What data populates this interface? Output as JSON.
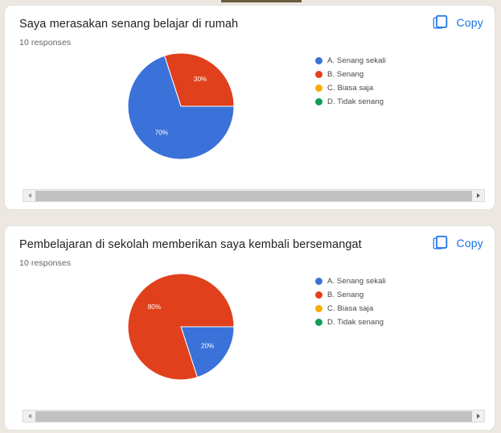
{
  "page": {
    "background_color": "#ece8e1",
    "tab_underline_color": "#6b5b3e"
  },
  "palette": {
    "blue": "#3b72d9",
    "red": "#e1401c",
    "amber": "#f9ab00",
    "green": "#109d58",
    "link_blue": "#1a73e8"
  },
  "cards": [
    {
      "title": "Saya merasakan senang belajar di rumah",
      "responses": "10 responses",
      "copy_label": "Copy",
      "chart_data": {
        "type": "pie",
        "title": "Saya merasakan senang belajar di rumah",
        "total_responses": 10,
        "categories": [
          "A. Senang sekali",
          "B. Senang",
          "C. Biasa saja",
          "D. Tidak senang"
        ],
        "values": [
          70,
          30,
          0,
          0
        ],
        "value_labels": [
          "70%",
          "30%",
          "",
          ""
        ],
        "colors": [
          "#3b72d9",
          "#e1401c",
          "#f9ab00",
          "#109d58"
        ],
        "legend": [
          "A. Senang sekali",
          "B. Senang",
          "C. Biasa saja",
          "D. Tidak senang"
        ],
        "legend_position": "right",
        "start_angle_deg": -18,
        "slices": [
          {
            "label": "A. Senang sekali",
            "percent": 70,
            "text": "70%",
            "color": "#3b72d9",
            "start_deg": 90,
            "sweep_deg": 252
          },
          {
            "label": "B. Senang",
            "percent": 30,
            "text": "30%",
            "color": "#e1401c",
            "start_deg": 342,
            "sweep_deg": 108
          },
          {
            "label": "C. Biasa saja",
            "percent": 0,
            "text": "",
            "color": "#f9ab00",
            "start_deg": 90,
            "sweep_deg": 0
          },
          {
            "label": "D. Tidak senang",
            "percent": 0,
            "text": "",
            "color": "#109d58",
            "start_deg": 90,
            "sweep_deg": 0
          }
        ]
      }
    },
    {
      "title": "Pembelajaran di sekolah memberikan saya kembali bersemangat",
      "responses": "10 responses",
      "copy_label": "Copy",
      "chart_data": {
        "type": "pie",
        "title": "Pembelajaran di sekolah memberikan saya kembali bersemangat",
        "total_responses": 10,
        "categories": [
          "A. Senang sekali",
          "B. Senang",
          "C. Biasa saja",
          "D. Tidak senang"
        ],
        "values": [
          20,
          80,
          0,
          0
        ],
        "value_labels": [
          "20%",
          "80%",
          "",
          ""
        ],
        "colors": [
          "#3b72d9",
          "#e1401c",
          "#f9ab00",
          "#109d58"
        ],
        "legend": [
          "A. Senang sekali",
          "B. Senang",
          "C. Biasa saja",
          "D. Tidak senang"
        ],
        "legend_position": "right",
        "start_angle_deg": 90,
        "slices": [
          {
            "label": "A. Senang sekali",
            "percent": 20,
            "text": "20%",
            "color": "#3b72d9",
            "start_deg": 90,
            "sweep_deg": 72
          },
          {
            "label": "B. Senang",
            "percent": 80,
            "text": "80%",
            "color": "#e1401c",
            "start_deg": 162,
            "sweep_deg": 288
          },
          {
            "label": "C. Biasa saja",
            "percent": 0,
            "text": "",
            "color": "#f9ab00",
            "start_deg": 90,
            "sweep_deg": 0
          },
          {
            "label": "D. Tidak senang",
            "percent": 0,
            "text": "",
            "color": "#109d58",
            "start_deg": 90,
            "sweep_deg": 0
          }
        ]
      }
    }
  ],
  "scrollbar": {
    "left_arrow_icon": "triangle-left-icon",
    "right_arrow_icon": "triangle-right-icon"
  }
}
